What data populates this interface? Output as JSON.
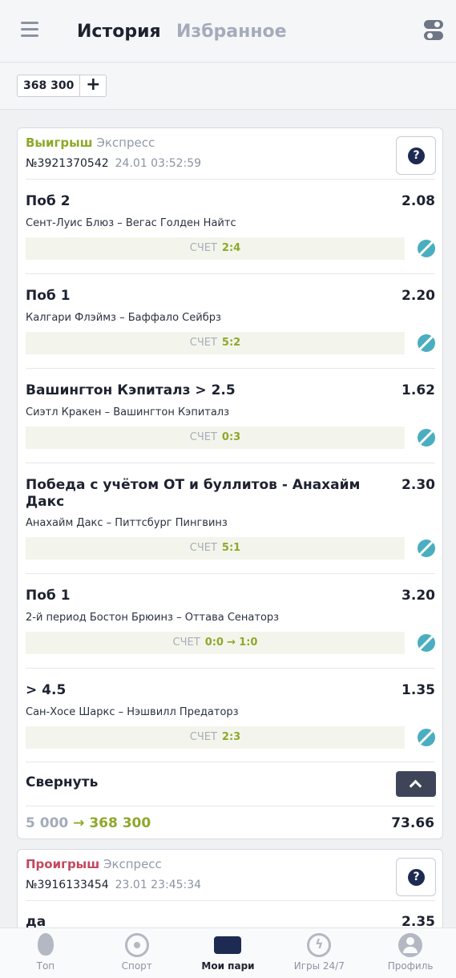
{
  "header": {
    "tab_history": "История",
    "tab_favorites": "Избранное"
  },
  "sum": {
    "value": "368 300",
    "plus": "+"
  },
  "card1": {
    "status": "Выигрыш",
    "type": "Экспресс",
    "bet_id": "№3921370542",
    "datetime": "24.01 03:52:59",
    "help": "?",
    "events": [
      {
        "title": "Поб 2",
        "odds": "2.08",
        "teams": "Сент-Луис Блюз – Вегас Голден Найтс",
        "score_label": "СЧЕТ",
        "score": "2:4"
      },
      {
        "title": "Поб 1",
        "odds": "2.20",
        "teams": "Калгари Флэймз – Баффало Сейбрз",
        "score_label": "СЧЕТ",
        "score": "5:2"
      },
      {
        "title": "Вашингтон Кэпиталз > 2.5",
        "odds": "1.62",
        "teams": "Сиэтл Кракен – Вашингтон Кэпиталз",
        "score_label": "СЧЕТ",
        "score": "0:3"
      },
      {
        "title": "Победа с учётом ОТ и буллитов - Анахайм Дакс",
        "odds": "2.30",
        "teams": "Анахайм Дакс – Питтсбург Пингвинз",
        "score_label": "СЧЕТ",
        "score": "5:1"
      },
      {
        "title": "Поб 1",
        "odds": "3.20",
        "teams": "2-й период Бостон Брюинз – Оттава Сенаторз",
        "score_label": "СЧЕТ",
        "score_from": "0:0",
        "score_arrow": "→",
        "score": "1:0"
      },
      {
        "title": "> 4.5",
        "odds": "1.35",
        "teams": "Сан-Хосе Шаркс – Нэшвилл Предаторз",
        "score_label": "СЧЕТ",
        "score": "2:3"
      }
    ],
    "collapse": "Свернуть",
    "stake": "5 000",
    "arrow": "→",
    "win": "368 300",
    "total_odds": "73.66"
  },
  "card2": {
    "status": "Проигрыш",
    "type": "Экспресс",
    "bet_id": "№3916133454",
    "datetime": "23.01 23:45:34",
    "help": "?",
    "event": {
      "title": "да",
      "odds": "2.35"
    }
  },
  "nav": [
    {
      "label": "Топ",
      "icon": "flame-icon"
    },
    {
      "label": "Спорт",
      "icon": "target-icon"
    },
    {
      "label": "Мои пари",
      "icon": "ticket-icon",
      "active": true
    },
    {
      "label": "Игры 24/7",
      "icon": "bolt-icon"
    },
    {
      "label": "Профиль",
      "icon": "profile-icon"
    }
  ]
}
